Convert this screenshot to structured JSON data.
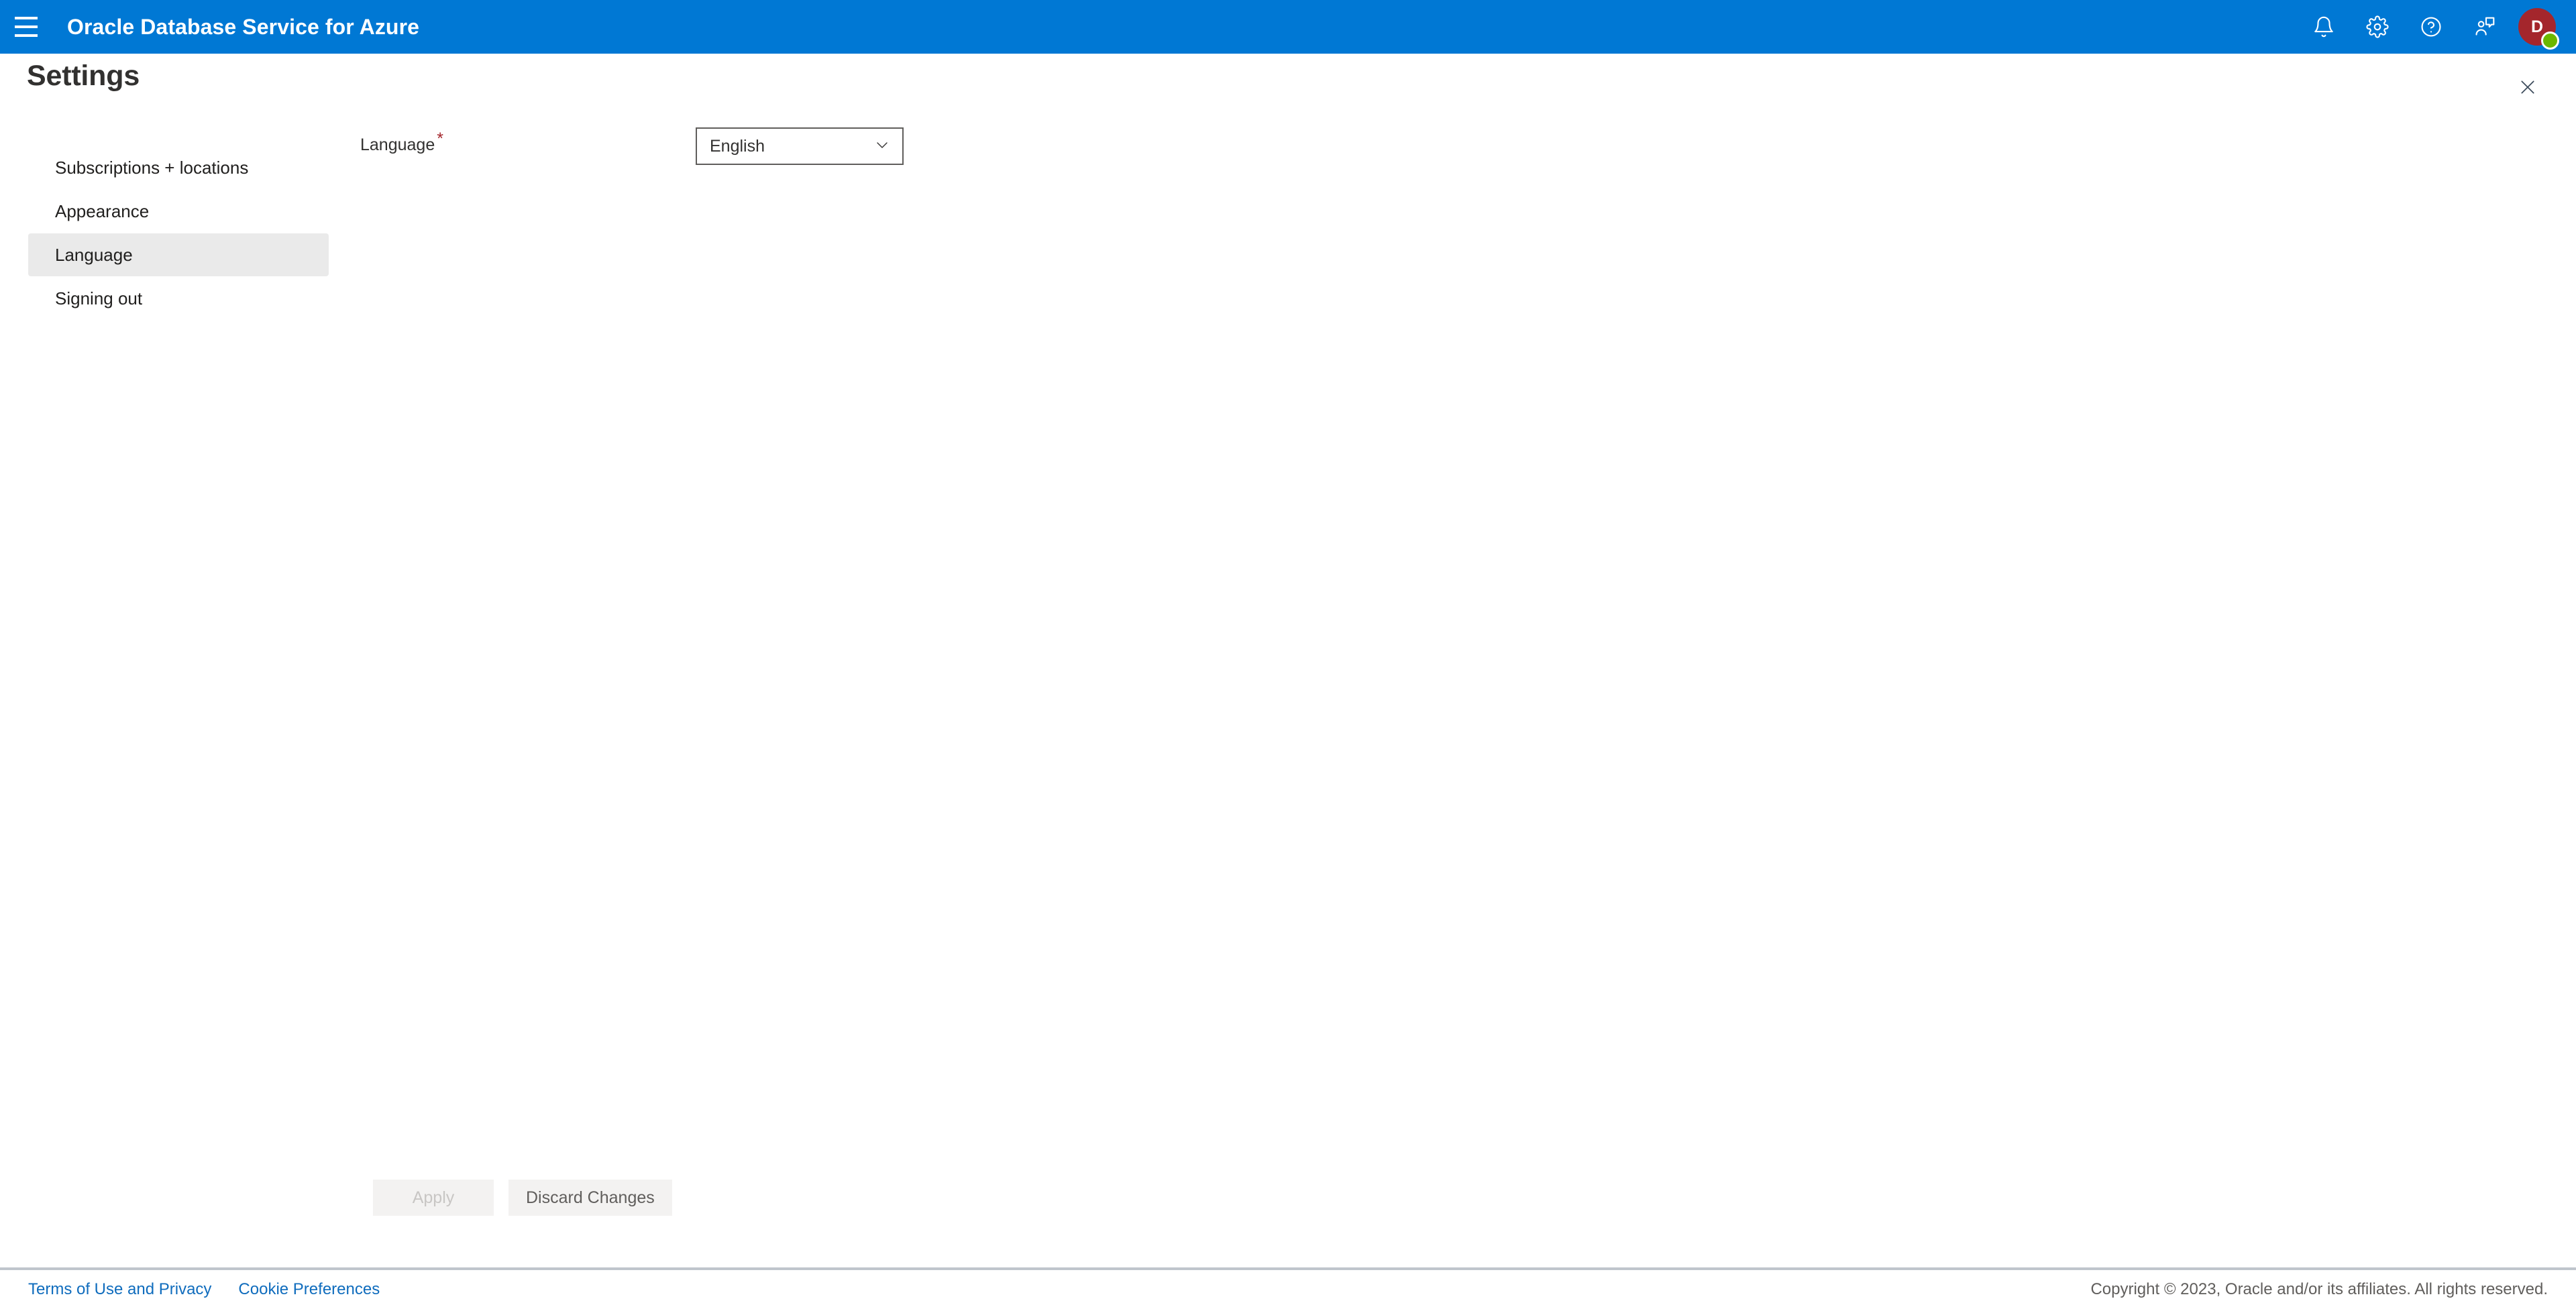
{
  "topbar": {
    "menu_icon": "hamburger-menu-icon",
    "app_title": "Oracle Database Service for Azure",
    "icons": [
      {
        "name": "notifications-icon",
        "label": "Notifications"
      },
      {
        "name": "settings-gear-icon",
        "label": "Settings"
      },
      {
        "name": "help-icon",
        "label": "Help"
      },
      {
        "name": "feedback-icon",
        "label": "Feedback"
      }
    ],
    "avatar": {
      "initial": "D",
      "background_color": "#a4262c",
      "presence_color": "#6bb700"
    },
    "background_color": "#0078d4"
  },
  "page": {
    "title": "Settings",
    "close_icon": "close-icon"
  },
  "sidebar": {
    "items": [
      {
        "label": "Subscriptions + locations",
        "selected": false
      },
      {
        "label": "Appearance",
        "selected": false
      },
      {
        "label": "Language",
        "selected": true
      },
      {
        "label": "Signing out",
        "selected": false
      }
    ],
    "selected_background": "#eaeaea"
  },
  "form": {
    "language_field": {
      "label": "Language",
      "required_marker": "*",
      "required_color": "#a4262c",
      "value": "English",
      "chevron_icon": "chevron-down-icon"
    }
  },
  "actions": {
    "apply_label": "Apply",
    "apply_disabled": true,
    "discard_label": "Discard Changes"
  },
  "footer": {
    "links": [
      {
        "label": "Terms of Use and Privacy"
      },
      {
        "label": "Cookie Preferences"
      }
    ],
    "copyright": "Copyright © 2023, Oracle and/or its affiliates. All rights reserved.",
    "link_color": "#0f6cbd"
  }
}
